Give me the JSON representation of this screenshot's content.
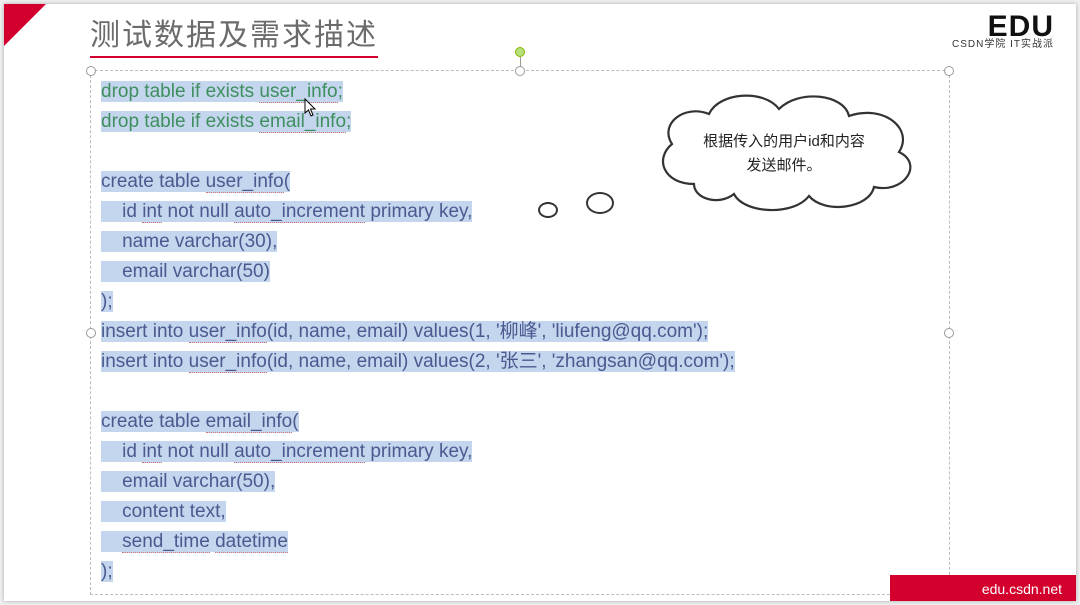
{
  "title": "测试数据及需求描述",
  "logo": {
    "main": "EDU",
    "sub": "CSDN学院   IT实战派"
  },
  "cloud": {
    "line1": "根据传入的用户id和内容",
    "line2": "发送邮件。"
  },
  "footer": "edu.csdn.net",
  "code": {
    "l1a": "drop table if exists ",
    "l1b": "user_info",
    "l1c": ";",
    "l2a": "drop table if exists ",
    "l2b": "email_info",
    "l2c": ";",
    "l3": "",
    "l4a": "create table ",
    "l4b": "user_info",
    "l4c": "(",
    "l5a": "    id ",
    "l5b": "int",
    "l5c": " not null ",
    "l5d": "auto_increment",
    "l5e": " primary key,",
    "l6": "    name varchar(30),",
    "l7": "    email varchar(50)",
    "l8": ");",
    "l9a": "insert into ",
    "l9b": "user_info",
    "l9c": "(id, name, email) values(1, '柳峰', 'liufeng@qq.com');",
    "l10a": "insert into ",
    "l10b": "user_info",
    "l10c": "(id, name, email) values(2, '张三', 'zhangsan@qq.com');",
    "l11": "",
    "l12a": "create table ",
    "l12b": "email_info",
    "l12c": "(",
    "l13a": "    id ",
    "l13b": "int",
    "l13c": " not null ",
    "l13d": "auto_increment",
    "l13e": " primary key,",
    "l14": "    email varchar(50),",
    "l15": "    content text,",
    "l16a": "    ",
    "l16b": "send_time",
    "l16c": " ",
    "l16d": "datetime",
    "l17": ");"
  }
}
